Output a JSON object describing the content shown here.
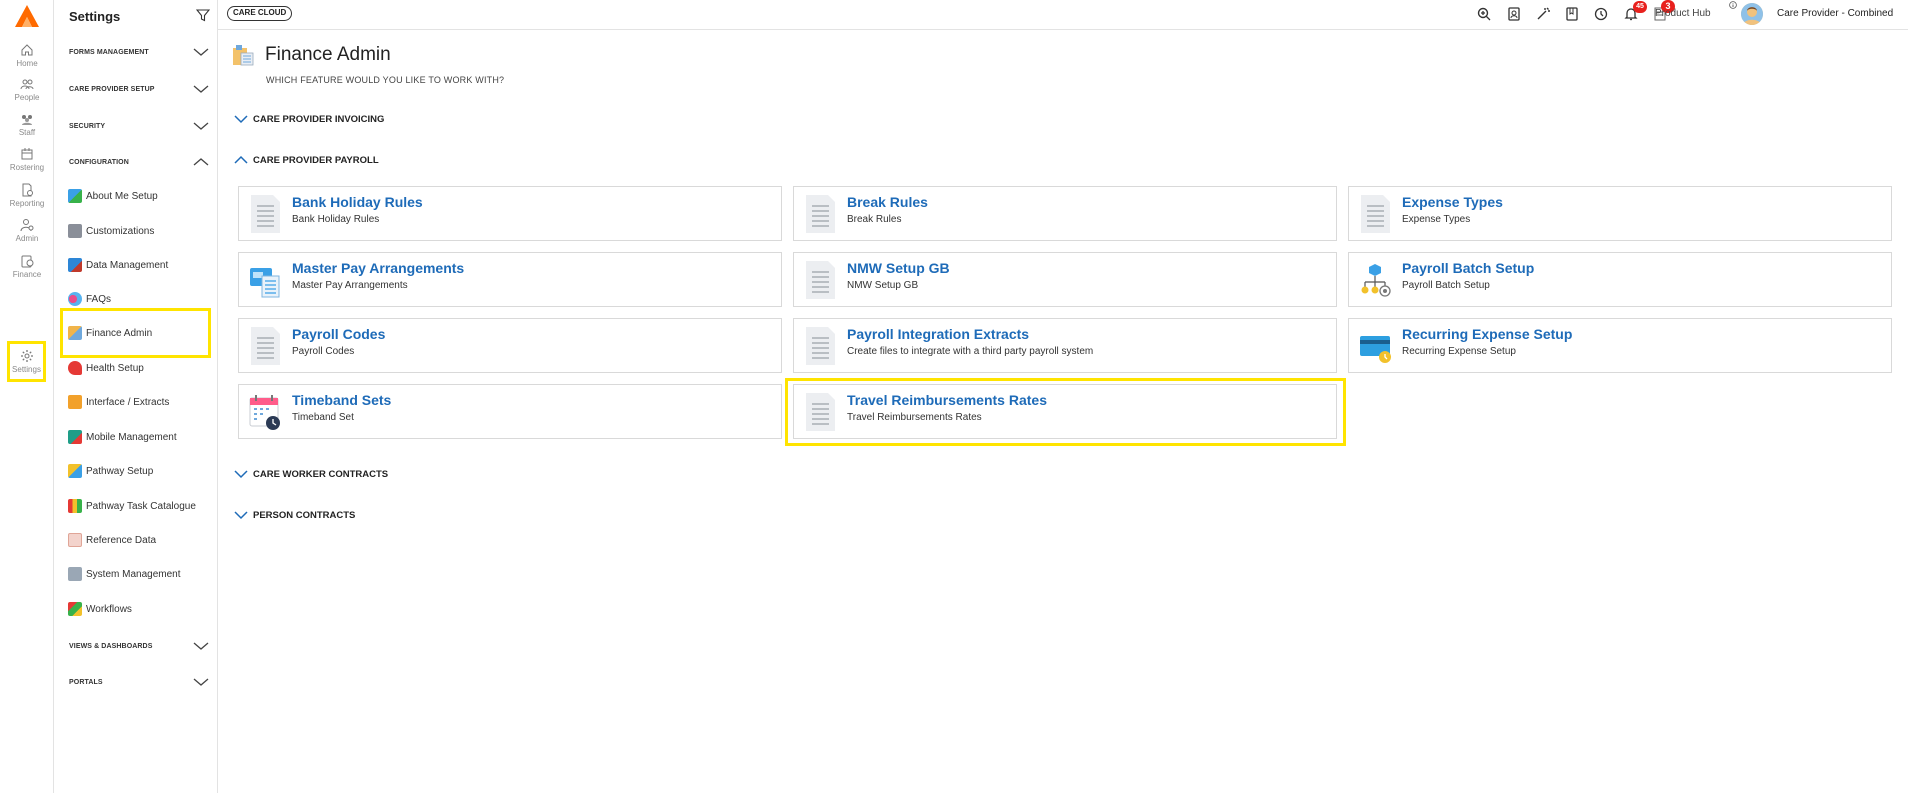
{
  "rail": {
    "items": [
      {
        "label": "Home",
        "icon": "home-icon"
      },
      {
        "label": "People",
        "icon": "people-icon"
      },
      {
        "label": "Staff",
        "icon": "staff-icon"
      },
      {
        "label": "Rostering",
        "icon": "rostering-icon"
      },
      {
        "label": "Reporting",
        "icon": "reporting-icon"
      },
      {
        "label": "Admin",
        "icon": "admin-icon"
      },
      {
        "label": "Finance",
        "icon": "finance-icon"
      },
      {
        "label": "Settings",
        "icon": "gear-icon"
      }
    ],
    "accent": "#ff6a00"
  },
  "sidebar": {
    "title": "Settings",
    "sections": [
      {
        "label": "FORMS MANAGEMENT",
        "expanded": false
      },
      {
        "label": "CARE PROVIDER SETUP",
        "expanded": false
      },
      {
        "label": "SECURITY",
        "expanded": false
      },
      {
        "label": "CONFIGURATION",
        "expanded": true
      },
      {
        "label": "VIEWS & DASHBOARDS",
        "expanded": false
      },
      {
        "label": "PORTALS",
        "expanded": false
      }
    ],
    "config_items": [
      {
        "label": "About Me Setup",
        "icon": "about-me-icon"
      },
      {
        "label": "Customizations",
        "icon": "customizations-icon"
      },
      {
        "label": "Data Management",
        "icon": "data-management-icon"
      },
      {
        "label": "FAQs",
        "icon": "faqs-icon"
      },
      {
        "label": "Finance Admin",
        "icon": "finance-admin-icon"
      },
      {
        "label": "Health Setup",
        "icon": "health-setup-icon"
      },
      {
        "label": "Interface / Extracts",
        "icon": "interface-extracts-icon"
      },
      {
        "label": "Mobile Management",
        "icon": "mobile-management-icon"
      },
      {
        "label": "Pathway Setup",
        "icon": "pathway-setup-icon"
      },
      {
        "label": "Pathway Task Catalogue",
        "icon": "pathway-task-catalogue-icon"
      },
      {
        "label": "Reference Data",
        "icon": "reference-data-icon"
      },
      {
        "label": "System Management",
        "icon": "system-management-icon"
      },
      {
        "label": "Workflows",
        "icon": "workflows-icon"
      }
    ],
    "active_item": "Finance Admin"
  },
  "topbar": {
    "cloud_label": "CARE CLOUD",
    "notification_count": "45",
    "product_hub_badge": "3",
    "product_hub_label": "Product Hub",
    "user_label": "Care Provider - Combined"
  },
  "main": {
    "title": "Finance Admin",
    "subtitle": "WHICH FEATURE WOULD YOU LIKE TO WORK WITH?",
    "groups": [
      {
        "label": "CARE PROVIDER INVOICING",
        "expanded": false
      },
      {
        "label": "CARE PROVIDER PAYROLL",
        "expanded": true
      },
      {
        "label": "CARE WORKER CONTRACTS",
        "expanded": false
      },
      {
        "label": "PERSON CONTRACTS",
        "expanded": false
      }
    ],
    "cards": [
      {
        "title": "Bank Holiday Rules",
        "subtitle": "Bank Holiday Rules",
        "icon": "document-icon"
      },
      {
        "title": "Break Rules",
        "subtitle": "Break Rules",
        "icon": "document-icon"
      },
      {
        "title": "Expense Types",
        "subtitle": "Expense Types",
        "icon": "document-icon"
      },
      {
        "title": "Master Pay Arrangements",
        "subtitle": "Master Pay Arrangements",
        "icon": "pay-arrangements-icon"
      },
      {
        "title": "NMW Setup GB",
        "subtitle": "NMW Setup GB",
        "icon": "document-icon"
      },
      {
        "title": "Payroll Batch Setup",
        "subtitle": "Payroll Batch Setup",
        "icon": "batch-setup-icon"
      },
      {
        "title": "Payroll Codes",
        "subtitle": "Payroll Codes",
        "icon": "document-icon"
      },
      {
        "title": "Payroll Integration Extracts",
        "subtitle": "Create files to integrate with a third party payroll system",
        "icon": "document-icon"
      },
      {
        "title": "Recurring Expense Setup",
        "subtitle": "Recurring Expense Setup",
        "icon": "credit-card-icon"
      },
      {
        "title": "Timeband Sets",
        "subtitle": "Timeband Set",
        "icon": "calendar-icon"
      },
      {
        "title": "Travel Reimbursements Rates",
        "subtitle": "Travel Reimbursements Rates",
        "icon": "document-icon"
      }
    ],
    "highlighted_card": "Travel Reimbursements Rates",
    "colors": {
      "link": "#1e6bb8",
      "highlight": "#ffe400",
      "chevron": "#1e6bb8"
    }
  }
}
